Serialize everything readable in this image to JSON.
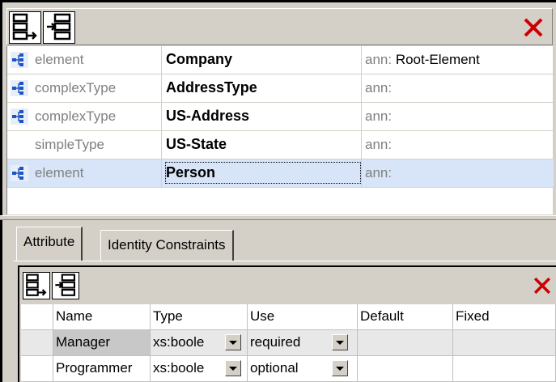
{
  "toolbar": {
    "buttons": [
      {
        "icon": "append-icon"
      },
      {
        "icon": "insert-icon"
      }
    ],
    "close_icon": "close-icon",
    "close_color": "#cc0000"
  },
  "schema_components": [
    {
      "kind": "element",
      "name": "Company",
      "ann_prefix": "ann:",
      "ann_value": "Root-Element",
      "has_icon": true
    },
    {
      "kind": "complexType",
      "name": "AddressType",
      "ann_prefix": "ann:",
      "ann_value": "",
      "has_icon": true
    },
    {
      "kind": "complexType",
      "name": "US-Address",
      "ann_prefix": "ann:",
      "ann_value": "",
      "has_icon": true
    },
    {
      "kind": "simpleType",
      "name": "US-State",
      "ann_prefix": "ann:",
      "ann_value": "",
      "has_icon": false
    },
    {
      "kind": "element",
      "name": "Person",
      "ann_prefix": "ann:",
      "ann_value": "",
      "has_icon": true,
      "selected": true
    }
  ],
  "tabs": [
    {
      "label": "Attribute",
      "active": true
    },
    {
      "label": "Identity Constraints",
      "active": false
    }
  ],
  "attributes": {
    "columns": [
      "Name",
      "Type",
      "Use",
      "Default",
      "Fixed"
    ],
    "rows": [
      {
        "name": "Manager",
        "type": "xs:boole",
        "use": "required",
        "default": "",
        "fixed": ""
      },
      {
        "name": "Programmer",
        "type": "xs:boole",
        "use": "optional",
        "default": "",
        "fixed": ""
      }
    ]
  },
  "colors": {
    "selected_row": "#d8e4f8",
    "icon_blue": "#1c54c8",
    "chrome": "#d4d0c8"
  }
}
